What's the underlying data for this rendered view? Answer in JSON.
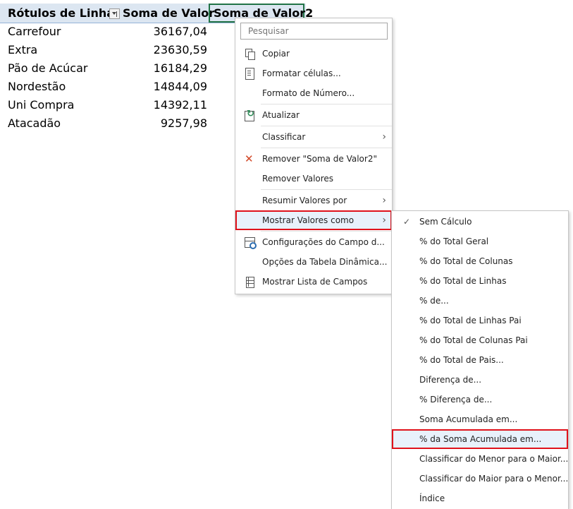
{
  "pivot": {
    "headers": [
      "Rótulos de Linha",
      "Soma de Valor",
      "Soma de Valor2"
    ],
    "rows": [
      {
        "label": "Carrefour",
        "value": "36167,04"
      },
      {
        "label": "Extra",
        "value": "23630,59"
      },
      {
        "label": "Pão de Acúcar",
        "value": "16184,29"
      },
      {
        "label": "Nordestão",
        "value": "14844,09"
      },
      {
        "label": "Uni Compra",
        "value": "14392,11"
      },
      {
        "label": "Atacadão",
        "value": "9257,98"
      }
    ]
  },
  "menu": {
    "search_placeholder": "Pesquisar",
    "items": [
      {
        "label": "Copiar",
        "icon": "copy-icon"
      },
      {
        "label": "Formatar células...",
        "icon": "format-cells-icon"
      },
      {
        "label": "Formato de Número..."
      },
      {
        "label": "Atualizar",
        "icon": "refresh-icon"
      },
      {
        "label": "Classificar",
        "arrow": "›"
      },
      {
        "label": "Remover \"Soma de Valor2\"",
        "icon": "remove-icon"
      },
      {
        "label": "Remover Valores"
      },
      {
        "label": "Resumir Valores por",
        "arrow": "›"
      },
      {
        "label": "Mostrar Valores como",
        "arrow": "›"
      },
      {
        "label": "Configurações do Campo d...",
        "icon": "field-settings-icon"
      },
      {
        "label": "Opções da Tabela Dinâmica..."
      },
      {
        "label": "Mostrar Lista de Campos",
        "icon": "field-list-icon"
      }
    ]
  },
  "submenu": {
    "check": "✓",
    "items": [
      "Sem Cálculo",
      "% do Total Geral",
      "% do Total de Colunas",
      "% do Total de Linhas",
      "% de...",
      "% do Total de Linhas Pai",
      "% do Total de Colunas Pai",
      "% do Total de Pais...",
      "Diferença de...",
      "% Diferença de...",
      "Soma Acumulada em...",
      "% da Soma Acumulada em...",
      "Classificar do Menor para o Maior...",
      "Classificar do Maior para o Menor...",
      "Índice"
    ]
  },
  "colors": {
    "highlight_border": "#e0121b",
    "header_bg": "#dce6f1",
    "selected_cell_border": "#217346"
  }
}
